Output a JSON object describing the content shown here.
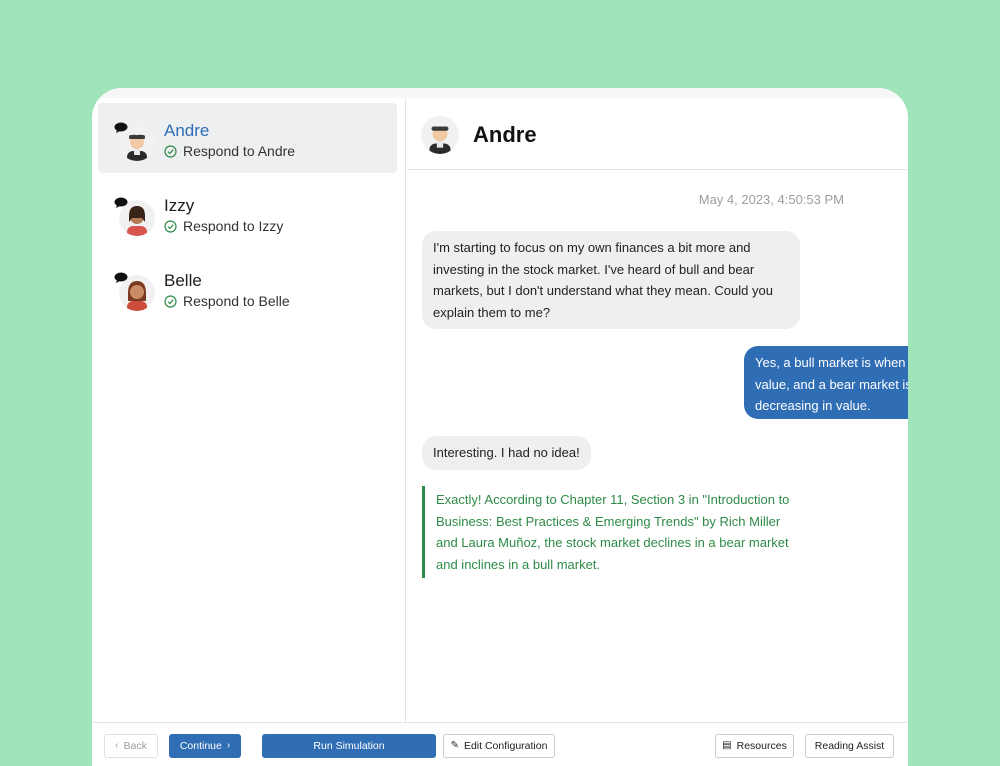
{
  "contacts": [
    {
      "name": "Andre",
      "status": "Respond to Andre",
      "avatar": "andre-avatar"
    },
    {
      "name": "Izzy",
      "status": "Respond to Izzy",
      "avatar": "izzy-avatar"
    },
    {
      "name": "Belle",
      "status": "Respond to Belle",
      "avatar": "belle-avatar"
    }
  ],
  "chat": {
    "title": "Andre",
    "timestamp": "May 4, 2023, 4:50:53 PM",
    "messages": [
      {
        "from": "Andre",
        "text": "I'm starting to focus on my own finances a bit more and investing in the stock market. I've heard of bull and bear markets, but I don't understand what they mean. Could you explain them to me?"
      },
      {
        "from": "user",
        "text": "Yes, a bull market is when value, and a bear market is decreasing in value."
      },
      {
        "from": "Andre",
        "text": "Interesting. I had no idea!"
      },
      {
        "from": "note",
        "text": "Exactly! According to Chapter 11, Section 3 in \"Introduction to Business: Best Practices & Emerging Trends\" by Rich Miller and Laura Muñoz, the stock market declines in a bear market and inclines in a bull market."
      }
    ]
  },
  "footer": {
    "back": "Back",
    "continue": "Continue",
    "run": "Run Simulation",
    "edit": "Edit Configuration",
    "resources": "Resources",
    "reading": "Reading Assist"
  },
  "colors": {
    "background": "#9fe5b9",
    "accent": "#2f6db5",
    "quote": "#2e8b47"
  }
}
